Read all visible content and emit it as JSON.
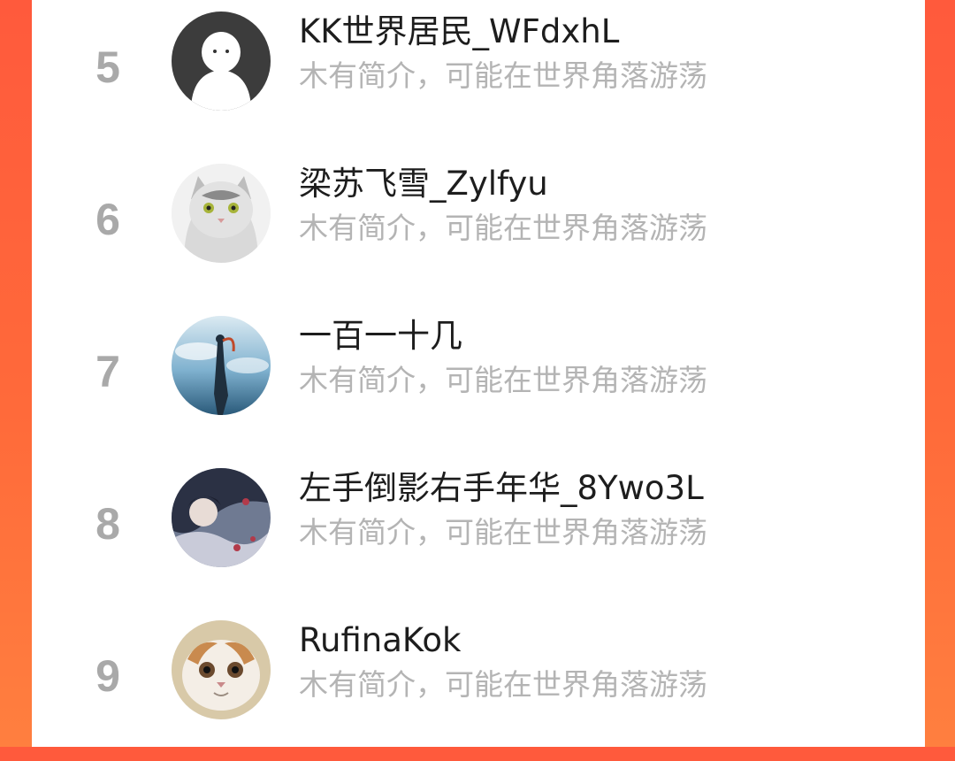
{
  "users": [
    {
      "rank": "5",
      "name": "KK世界居民_WFdxhL",
      "bio": "木有简介，可能在世界角落游荡",
      "avatar_icon": "ghost-default-avatar"
    },
    {
      "rank": "6",
      "name": "梁苏飞雪_Zylfyu",
      "bio": "木有简介，可能在世界角落游荡",
      "avatar_icon": "cat-avatar"
    },
    {
      "rank": "7",
      "name": "一百一十几",
      "bio": "木有简介，可能在世界角落游荡",
      "avatar_icon": "sky-figure-avatar"
    },
    {
      "rank": "8",
      "name": "左手倒影右手年华_8Ywo3L",
      "bio": "木有简介，可能在世界角落游荡",
      "avatar_icon": "anime-art-avatar"
    },
    {
      "rank": "9",
      "name": "RufinaKok",
      "bio": "木有简介，可能在世界角落游荡",
      "avatar_icon": "exotic-cat-avatar"
    }
  ],
  "colors": {
    "background_accent": "#ff5a3c",
    "rank": "#a9a9a9",
    "name": "#1d1d1d",
    "bio": "#b4b4b4"
  }
}
